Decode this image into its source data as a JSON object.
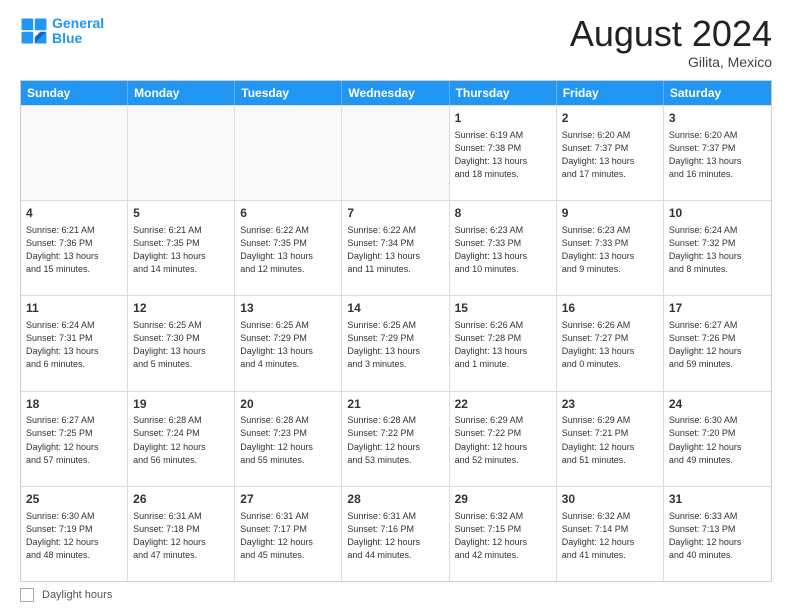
{
  "header": {
    "logo_line1": "General",
    "logo_line2": "Blue",
    "month_title": "August 2024",
    "location": "Gilita, Mexico"
  },
  "calendar": {
    "days_of_week": [
      "Sunday",
      "Monday",
      "Tuesday",
      "Wednesday",
      "Thursday",
      "Friday",
      "Saturday"
    ],
    "rows": [
      [
        {
          "day": "",
          "info": ""
        },
        {
          "day": "",
          "info": ""
        },
        {
          "day": "",
          "info": ""
        },
        {
          "day": "",
          "info": ""
        },
        {
          "day": "1",
          "info": "Sunrise: 6:19 AM\nSunset: 7:38 PM\nDaylight: 13 hours\nand 18 minutes."
        },
        {
          "day": "2",
          "info": "Sunrise: 6:20 AM\nSunset: 7:37 PM\nDaylight: 13 hours\nand 17 minutes."
        },
        {
          "day": "3",
          "info": "Sunrise: 6:20 AM\nSunset: 7:37 PM\nDaylight: 13 hours\nand 16 minutes."
        }
      ],
      [
        {
          "day": "4",
          "info": "Sunrise: 6:21 AM\nSunset: 7:36 PM\nDaylight: 13 hours\nand 15 minutes."
        },
        {
          "day": "5",
          "info": "Sunrise: 6:21 AM\nSunset: 7:35 PM\nDaylight: 13 hours\nand 14 minutes."
        },
        {
          "day": "6",
          "info": "Sunrise: 6:22 AM\nSunset: 7:35 PM\nDaylight: 13 hours\nand 12 minutes."
        },
        {
          "day": "7",
          "info": "Sunrise: 6:22 AM\nSunset: 7:34 PM\nDaylight: 13 hours\nand 11 minutes."
        },
        {
          "day": "8",
          "info": "Sunrise: 6:23 AM\nSunset: 7:33 PM\nDaylight: 13 hours\nand 10 minutes."
        },
        {
          "day": "9",
          "info": "Sunrise: 6:23 AM\nSunset: 7:33 PM\nDaylight: 13 hours\nand 9 minutes."
        },
        {
          "day": "10",
          "info": "Sunrise: 6:24 AM\nSunset: 7:32 PM\nDaylight: 13 hours\nand 8 minutes."
        }
      ],
      [
        {
          "day": "11",
          "info": "Sunrise: 6:24 AM\nSunset: 7:31 PM\nDaylight: 13 hours\nand 6 minutes."
        },
        {
          "day": "12",
          "info": "Sunrise: 6:25 AM\nSunset: 7:30 PM\nDaylight: 13 hours\nand 5 minutes."
        },
        {
          "day": "13",
          "info": "Sunrise: 6:25 AM\nSunset: 7:29 PM\nDaylight: 13 hours\nand 4 minutes."
        },
        {
          "day": "14",
          "info": "Sunrise: 6:25 AM\nSunset: 7:29 PM\nDaylight: 13 hours\nand 3 minutes."
        },
        {
          "day": "15",
          "info": "Sunrise: 6:26 AM\nSunset: 7:28 PM\nDaylight: 13 hours\nand 1 minute."
        },
        {
          "day": "16",
          "info": "Sunrise: 6:26 AM\nSunset: 7:27 PM\nDaylight: 13 hours\nand 0 minutes."
        },
        {
          "day": "17",
          "info": "Sunrise: 6:27 AM\nSunset: 7:26 PM\nDaylight: 12 hours\nand 59 minutes."
        }
      ],
      [
        {
          "day": "18",
          "info": "Sunrise: 6:27 AM\nSunset: 7:25 PM\nDaylight: 12 hours\nand 57 minutes."
        },
        {
          "day": "19",
          "info": "Sunrise: 6:28 AM\nSunset: 7:24 PM\nDaylight: 12 hours\nand 56 minutes."
        },
        {
          "day": "20",
          "info": "Sunrise: 6:28 AM\nSunset: 7:23 PM\nDaylight: 12 hours\nand 55 minutes."
        },
        {
          "day": "21",
          "info": "Sunrise: 6:28 AM\nSunset: 7:22 PM\nDaylight: 12 hours\nand 53 minutes."
        },
        {
          "day": "22",
          "info": "Sunrise: 6:29 AM\nSunset: 7:22 PM\nDaylight: 12 hours\nand 52 minutes."
        },
        {
          "day": "23",
          "info": "Sunrise: 6:29 AM\nSunset: 7:21 PM\nDaylight: 12 hours\nand 51 minutes."
        },
        {
          "day": "24",
          "info": "Sunrise: 6:30 AM\nSunset: 7:20 PM\nDaylight: 12 hours\nand 49 minutes."
        }
      ],
      [
        {
          "day": "25",
          "info": "Sunrise: 6:30 AM\nSunset: 7:19 PM\nDaylight: 12 hours\nand 48 minutes."
        },
        {
          "day": "26",
          "info": "Sunrise: 6:31 AM\nSunset: 7:18 PM\nDaylight: 12 hours\nand 47 minutes."
        },
        {
          "day": "27",
          "info": "Sunrise: 6:31 AM\nSunset: 7:17 PM\nDaylight: 12 hours\nand 45 minutes."
        },
        {
          "day": "28",
          "info": "Sunrise: 6:31 AM\nSunset: 7:16 PM\nDaylight: 12 hours\nand 44 minutes."
        },
        {
          "day": "29",
          "info": "Sunrise: 6:32 AM\nSunset: 7:15 PM\nDaylight: 12 hours\nand 42 minutes."
        },
        {
          "day": "30",
          "info": "Sunrise: 6:32 AM\nSunset: 7:14 PM\nDaylight: 12 hours\nand 41 minutes."
        },
        {
          "day": "31",
          "info": "Sunrise: 6:33 AM\nSunset: 7:13 PM\nDaylight: 12 hours\nand 40 minutes."
        }
      ]
    ]
  },
  "footer": {
    "daylight_label": "Daylight hours"
  }
}
